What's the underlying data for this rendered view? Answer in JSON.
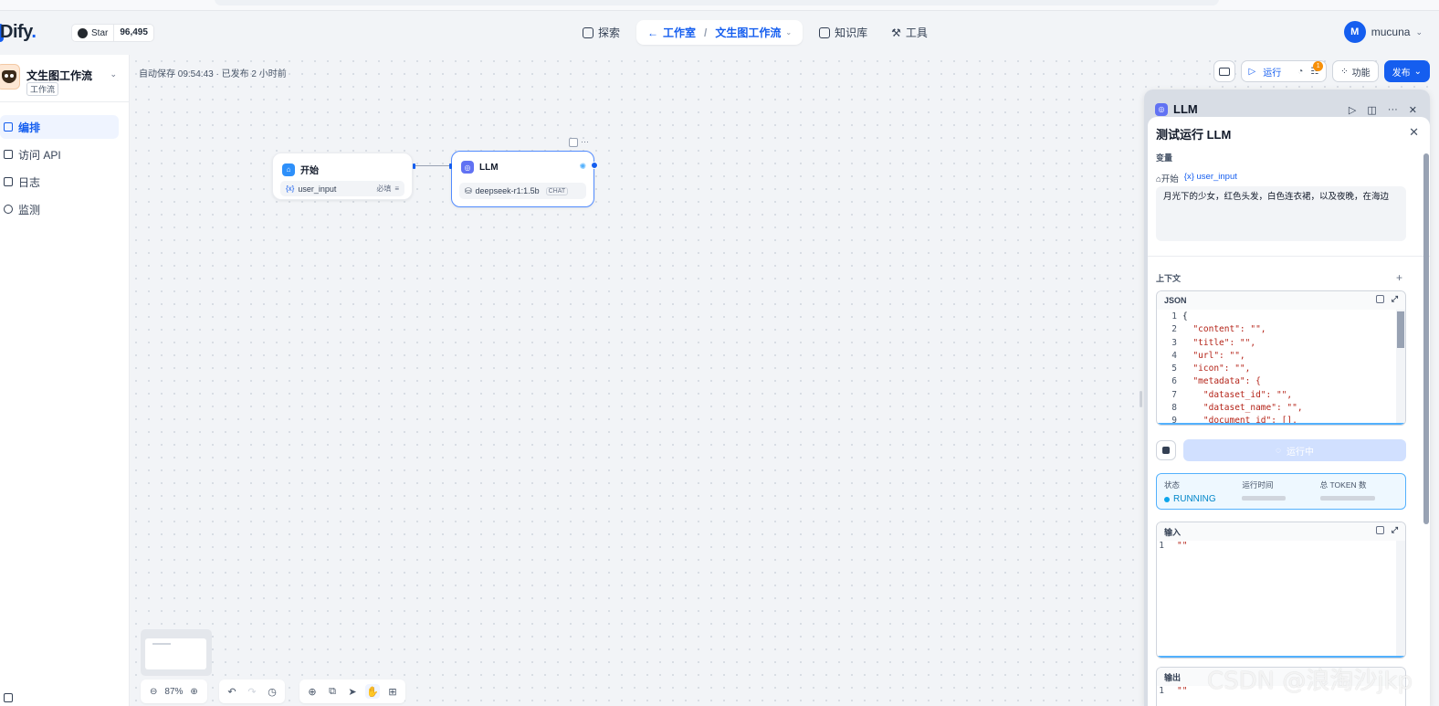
{
  "header": {
    "logo": "Dify",
    "logo_dot": ".",
    "github_star_label": "Star",
    "github_star_count": "96,495",
    "nav": {
      "explore": "探索",
      "studio": "工作室",
      "app": "文生图工作流",
      "knowledge": "知识库",
      "tools": "工具"
    },
    "user": {
      "initial": "M",
      "name": "mucuna"
    }
  },
  "sidebar": {
    "app_name": "文生图工作流",
    "app_type": "工作流",
    "items": [
      {
        "label": "编排",
        "active": true
      },
      {
        "label": "访问 API",
        "active": false
      },
      {
        "label": "日志",
        "active": false
      },
      {
        "label": "监测",
        "active": false
      }
    ]
  },
  "canvas": {
    "autosave_text": "自动保存 09:54:43 · 已发布 2 小时前",
    "nodes": {
      "start": {
        "title": "开始",
        "var_symbol": "{x}",
        "var_name": "user_input",
        "required": "必填"
      },
      "llm": {
        "title": "LLM",
        "model": "deepseek-r1:1.5b",
        "model_badge": "CHAT"
      }
    },
    "zoom": "87%"
  },
  "toolbar": {
    "run": "运行",
    "features": "功能",
    "publish": "发布",
    "badge_count": "1"
  },
  "panel": {
    "node_title": "LLM",
    "title": "测试运行 LLM",
    "variables_label": "变量",
    "var_source": "开始",
    "var_symbol": "{x}",
    "var_name": "user_input",
    "input_value": "月光下的少女，红色头发，白色连衣裙，以及夜晚，在海边",
    "context_label": "上下文",
    "json_label": "JSON",
    "json_lines": [
      {
        "n": "1",
        "text": "{"
      },
      {
        "n": "2",
        "text": "  \"content\": \"\","
      },
      {
        "n": "3",
        "text": "  \"title\": \"\","
      },
      {
        "n": "4",
        "text": "  \"url\": \"\","
      },
      {
        "n": "5",
        "text": "  \"icon\": \"\","
      },
      {
        "n": "6",
        "text": "  \"metadata\": {"
      },
      {
        "n": "7",
        "text": "    \"dataset_id\": \"\","
      },
      {
        "n": "8",
        "text": "    \"dataset_name\": \"\","
      },
      {
        "n": "9",
        "text": "    \"document_id\": [],"
      }
    ],
    "run_button": "运行中",
    "status": {
      "state_label": "状态",
      "state_value": "RUNNING",
      "time_label": "运行时间",
      "tokens_label": "总 TOKEN 数"
    },
    "input_label": "输入",
    "input_code": [
      {
        "n": "1",
        "text": "\"\""
      }
    ],
    "output_label": "输出",
    "output_code": [
      {
        "n": "1",
        "text": "\"\""
      }
    ]
  },
  "watermark": "CSDN @浪淘沙jkp"
}
